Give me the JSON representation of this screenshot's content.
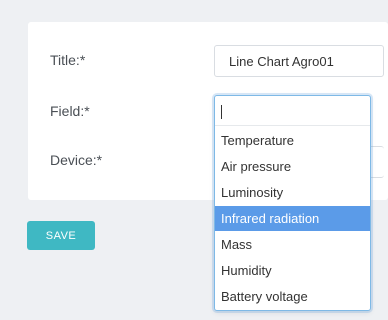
{
  "form": {
    "title_label": "Title:*",
    "title_value": "Line Chart Agro01",
    "field_label": "Field:*",
    "field_search_value": "",
    "device_label": "Device:*",
    "device_value": ""
  },
  "field_dropdown": {
    "options": [
      "Temperature",
      "Air pressure",
      "Luminosity",
      "Infrared radiation",
      "Mass",
      "Humidity",
      "Battery voltage"
    ],
    "highlighted": "Infrared radiation"
  },
  "actions": {
    "save_label": "SAVE"
  },
  "colors": {
    "accent": "#3fb8c3",
    "highlight": "#5b9be8",
    "focus_border": "#7eb9e6",
    "background": "#eef0f3"
  }
}
